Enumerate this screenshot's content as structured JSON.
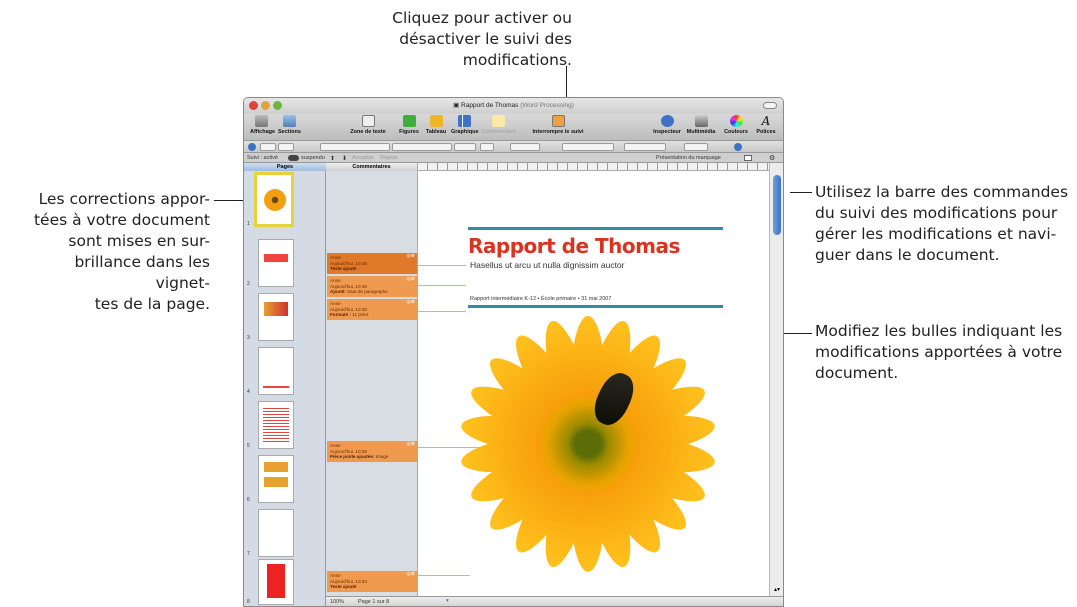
{
  "callouts": {
    "top": "Cliquez pour activer ou\ndésactiver le suivi des\nmodifications.",
    "left": "Les corrections appor-\ntées à votre document\nsont mises en sur-\nbrillance dans les vignet-\ntes de la page.",
    "right_top": "Utilisez la barre des commandes\ndu suivi des modifications pour\ngérer les modifications et navi-\nguer dans le document.",
    "right_mid": "Modifiez les bulles indiquant les\nmodifications apportées à votre\ndocument."
  },
  "window": {
    "title": "Rapport de Thomas",
    "title_suffix": "(Word Processing)"
  },
  "toolbar": {
    "affichage": "Affichage",
    "sections": "Sections",
    "zone_texte": "Zone de texte",
    "figures": "Figures",
    "tableau": "Tableau",
    "graphique": "Graphique",
    "commentaire": "Commentaire",
    "interrompre": "Interrompre le suivi",
    "inspecteur": "Inspecteur",
    "multimedia": "Multimédia",
    "couleurs": "Couleurs",
    "polices": "Polices",
    "polices_glyph": "A"
  },
  "trackbar": {
    "suivi": "Suivi : activé",
    "suspendu": "suspendu",
    "accept": "Accepter",
    "reject": "Rejeter",
    "presentation": "Présentation du marquage"
  },
  "sidebar": {
    "pages_header": "Pages",
    "comments_header": "Commentaires",
    "page_numbers": [
      "1",
      "2",
      "3",
      "4",
      "5",
      "6",
      "7",
      "8"
    ]
  },
  "bubbles": [
    {
      "author": "Anne",
      "date": "Aujourd'hui, 10:36",
      "change": "Texte ajouté",
      "detail": ""
    },
    {
      "author": "Anne",
      "date": "Aujourd'hui, 10:36",
      "change": "Ajouté:",
      "detail": "Saut de paragraphe"
    },
    {
      "author": "Anne",
      "date": "Aujourd'hui, 10:36",
      "change": "Formaté :",
      "detail": "11 point"
    },
    {
      "author": "Anne",
      "date": "Aujourd'hui, 10:35",
      "change": "Pièce jointe ajoutée:",
      "detail": "Image"
    },
    {
      "author": "Anne",
      "date": "Aujourd'hui, 10:34",
      "change": "Texte ajouté",
      "detail": ""
    }
  ],
  "document": {
    "title": "Rapport de Thomas",
    "subtitle": "Hasellus ut arcu ut nulla dignissim auctor",
    "info": "Rapport intermédiaire K-12 • École primaire • 31 mai 2007"
  },
  "status": {
    "zoom": "100%",
    "page": "Page 1 sur 8"
  },
  "colors": {
    "accent_teal": "#2e8fa0",
    "title_red": "#d9341f",
    "bubble": "#f09a50",
    "thumb_highlight": "#e6d23a"
  }
}
